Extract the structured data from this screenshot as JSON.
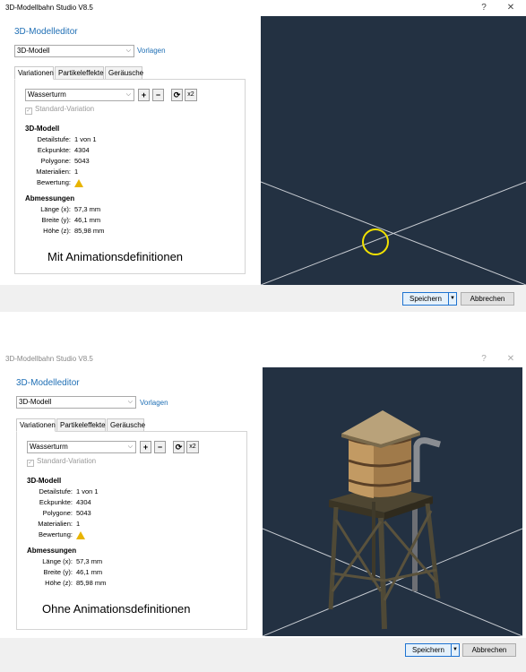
{
  "app_title": "3D-Modellbahn Studio V8.5",
  "help_glyph": "?",
  "close_glyph": "✕",
  "editor_title": "3D-Modelleditor",
  "model_select": "3D-Modell",
  "vorlagen_link": "Vorlagen",
  "tabs": [
    "Variationen",
    "Partikeleffekte",
    "Geräusche"
  ],
  "variation_select": "Wasserturm",
  "buttons": {
    "plus": "+",
    "minus": "−",
    "refresh": "⟳",
    "x2": "x2"
  },
  "standard_variation": "Standard-Variation",
  "model_section": "3D-Modell",
  "model_rows": [
    {
      "label": "Detailstufe:",
      "value": "1 von 1"
    },
    {
      "label": "Eckpunkte:",
      "value": "4304"
    },
    {
      "label": "Polygone:",
      "value": "5043"
    },
    {
      "label": "Materialien:",
      "value": "1"
    },
    {
      "label": "Bewertung:",
      "value": ""
    }
  ],
  "dim_section": "Abmessungen",
  "dim_rows": [
    {
      "label": "Länge (x):",
      "value": "57,3 mm"
    },
    {
      "label": "Breite (y):",
      "value": "46,1 mm"
    },
    {
      "label": "Höhe (z):",
      "value": "85,98 mm"
    }
  ],
  "caption_top": "Mit Animationsdefinitionen",
  "caption_bottom": "Ohne Animationsdefinitionen",
  "save_label": "Speichern",
  "cancel_label": "Abbrechen",
  "colors": {
    "viewport": "#233142",
    "accent": "#1f6fb5",
    "highlight_circle": "#f2e200"
  }
}
